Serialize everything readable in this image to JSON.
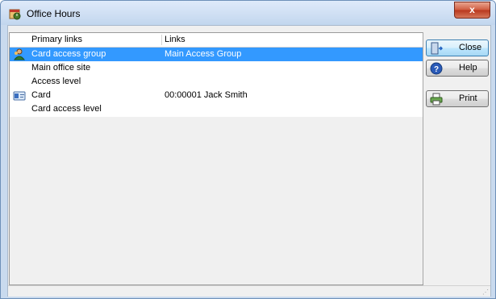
{
  "window": {
    "title": "Office Hours",
    "close_glyph": "x"
  },
  "list": {
    "columns": [
      "Primary links",
      "Links"
    ],
    "rows": [
      {
        "primary": "Card access group",
        "link": "Main Access Group",
        "icon": "card-access-group-icon",
        "selected": true
      },
      {
        "primary": "Main office site",
        "link": "",
        "icon": "",
        "selected": false
      },
      {
        "primary": "Access level",
        "link": "",
        "icon": "",
        "selected": false
      },
      {
        "primary": "Card",
        "link": "00:00001  Jack Smith",
        "icon": "card-icon",
        "selected": false
      },
      {
        "primary": "Card access level",
        "link": "",
        "icon": "",
        "selected": false
      }
    ]
  },
  "buttons": {
    "close": "Close",
    "help": "Help",
    "print": "Print"
  },
  "colors": {
    "selection": "#3399ff",
    "title_bg": "#c9daee",
    "close_button": "#c9462c"
  }
}
